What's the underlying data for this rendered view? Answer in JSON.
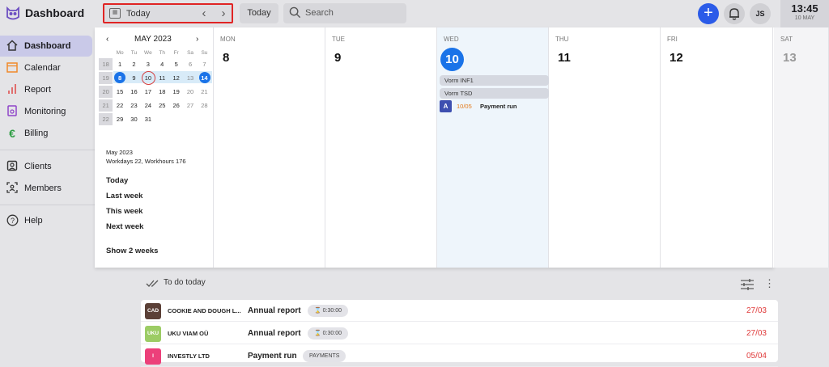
{
  "app": {
    "title": "Dashboard"
  },
  "toolbar": {
    "date_label": "Today",
    "today_button": "Today",
    "search_placeholder": "Search",
    "add_label": "+",
    "avatar_initials": "JS"
  },
  "clock": {
    "time": "13:45",
    "date": "10 MAY"
  },
  "sidebar": {
    "items": [
      {
        "label": "Dashboard",
        "icon": "home-icon"
      },
      {
        "label": "Calendar",
        "icon": "calendar-icon"
      },
      {
        "label": "Report",
        "icon": "bar-chart-icon"
      },
      {
        "label": "Monitoring",
        "icon": "monitoring-icon"
      },
      {
        "label": "Billing",
        "icon": "euro-icon"
      },
      {
        "label": "Clients",
        "icon": "clients-icon"
      },
      {
        "label": "Members",
        "icon": "members-icon"
      },
      {
        "label": "Help",
        "icon": "help-icon"
      }
    ]
  },
  "minical": {
    "month": "MAY 2023",
    "prev": "‹",
    "next": "›",
    "weekdays": [
      "Mo",
      "Tu",
      "We",
      "Th",
      "Fr",
      "Sa",
      "Su"
    ],
    "weeks": [
      {
        "wk": "18",
        "days": [
          "1",
          "2",
          "3",
          "4",
          "5",
          "6",
          "7"
        ]
      },
      {
        "wk": "19",
        "days": [
          "8",
          "9",
          "10",
          "11",
          "12",
          "13",
          "14"
        ]
      },
      {
        "wk": "20",
        "days": [
          "15",
          "16",
          "17",
          "18",
          "19",
          "20",
          "21"
        ]
      },
      {
        "wk": "21",
        "days": [
          "22",
          "23",
          "24",
          "25",
          "26",
          "27",
          "28"
        ]
      },
      {
        "wk": "22",
        "days": [
          "29",
          "30",
          "31",
          "",
          "",
          "",
          ""
        ]
      }
    ],
    "info_month": "May 2023",
    "info_hours": "Workdays 22, Workhours 176",
    "quick": [
      "Today",
      "Last week",
      "This week",
      "Next week",
      "Show 2 weeks"
    ]
  },
  "days": [
    {
      "name": "MON",
      "date": "8"
    },
    {
      "name": "TUE",
      "date": "9"
    },
    {
      "name": "WED",
      "date": "10"
    },
    {
      "name": "THU",
      "date": "11"
    },
    {
      "name": "FRI",
      "date": "12"
    },
    {
      "name": "SAT",
      "date": "13"
    }
  ],
  "wed_events": [
    {
      "label": "Vorm INF1"
    },
    {
      "label": "Vorm TSD"
    }
  ],
  "wed_task": {
    "badge": "A",
    "date": "10/05",
    "name": "Payment run"
  },
  "todo": {
    "heading": "To do today",
    "rows": [
      {
        "abbr": "CAD",
        "company": "COOKIE AND DOUGH L...",
        "title": "Annual report",
        "pill": "0:30:00",
        "due": "27/03",
        "color": "#5b4037"
      },
      {
        "abbr": "UKU",
        "company": "UKU VIAM OÜ",
        "title": "Annual report",
        "pill": "0:30:00",
        "due": "27/03",
        "color": "#9ccc65"
      },
      {
        "abbr": "I",
        "company": "INVESTLY LTD",
        "title": "Payment run",
        "pill": "PAYMENTS",
        "due": "05/04",
        "color": "#ec407a"
      }
    ]
  }
}
